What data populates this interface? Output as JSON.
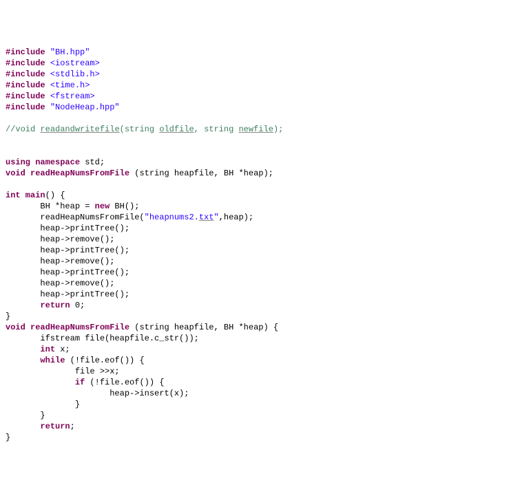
{
  "code": {
    "include1_kw": "#include",
    "include1_val": "\"BH.hpp\"",
    "include2_kw": "#include",
    "include2_val": "<iostream>",
    "include3_kw": "#include",
    "include3_val": "<stdlib.h>",
    "include4_kw": "#include",
    "include4_val": "<time.h>",
    "include5_kw": "#include",
    "include5_val": "<fstream>",
    "include6_kw": "#include",
    "include6_val": "\"NodeHeap.hpp\"",
    "comment_pre": "//void ",
    "comment_fn": "readandwritefile",
    "comment_mid1": "(string ",
    "comment_arg1": "oldfile",
    "comment_mid2": ", string ",
    "comment_arg2": "newfile",
    "comment_end": ");",
    "using_kw": "using",
    "namespace_kw": "namespace",
    "std_txt": " std;",
    "void_kw": "void",
    "readHeap_decl": " readHeapNumsFromFile",
    "readHeap_params": " (string heapfile, BH *heap);",
    "int_kw": "int",
    "main_txt": " main",
    "main_paren": "() {",
    "l_bh1": "       BH *heap = ",
    "new_kw": "new",
    "l_bh2": " BH();",
    "l_read1": "       readHeapNumsFromFile(",
    "l_read_str1": "\"heapnums2.",
    "l_read_str2": "txt",
    "l_read_str3": "\"",
    "l_read2": ",heap);",
    "l_print1": "       heap->printTree();",
    "l_remove1": "       heap->remove();",
    "l_print2": "       heap->printTree();",
    "l_remove2": "       heap->remove();",
    "l_print3": "       heap->printTree();",
    "l_remove3": "       heap->remove();",
    "l_print4": "       heap->printTree();",
    "return_kw": "return",
    "l_ret": "       ",
    "l_ret_val": " 0;",
    "rbrace": "}",
    "void2_kw": "void",
    "readHeap2_decl": " readHeapNumsFromFile",
    "readHeap2_params": " (string heapfile, BH *heap) {",
    "l_ifs": "       ifstream file(heapfile.c_str());",
    "l_intx1": "       ",
    "l_intx2": " x;",
    "l_while1": "       ",
    "while_kw": "while",
    "l_while2": " (!file.eof()) {",
    "l_filex": "              file >>x;",
    "l_if1": "              ",
    "if_kw": "if",
    "l_if2": " (!file.eof()) {",
    "l_insert": "                     heap->insert(x);",
    "l_cb1": "              }",
    "l_cb2": "       }",
    "l_ret2a": "       ",
    "l_ret2b": ";",
    "rbrace2": "}"
  }
}
